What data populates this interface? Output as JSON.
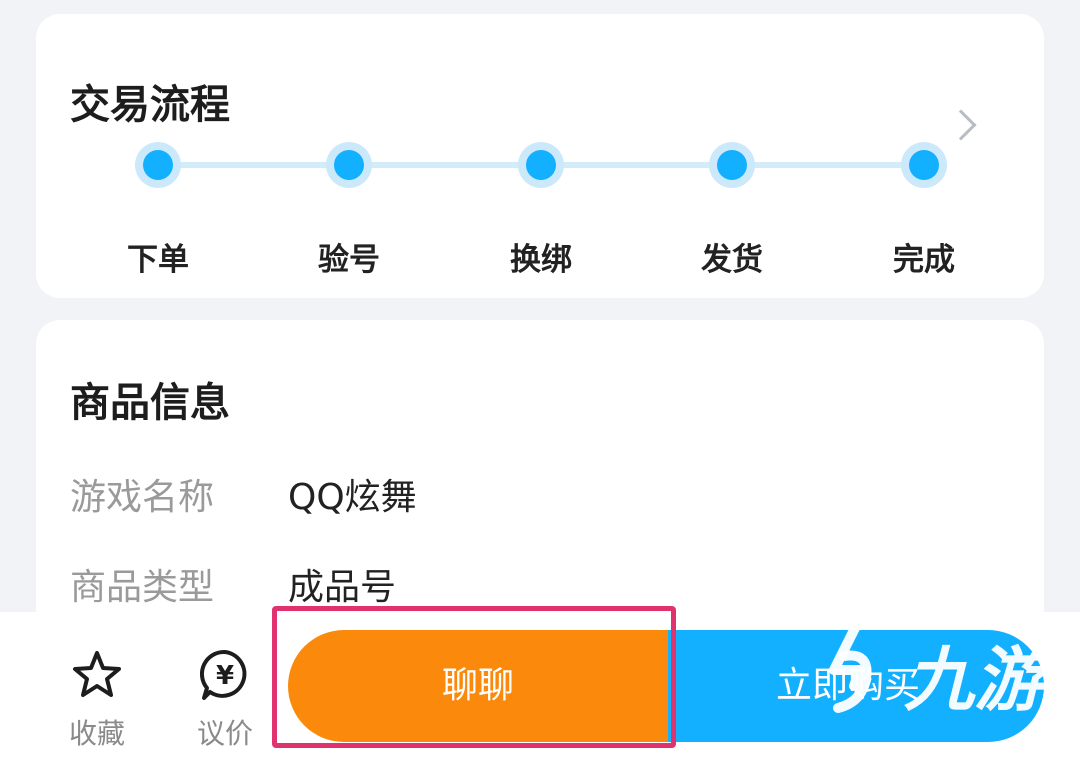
{
  "flow": {
    "title": "交易流程",
    "steps": [
      {
        "label": "下单"
      },
      {
        "label": "验号"
      },
      {
        "label": "换绑"
      },
      {
        "label": "发货"
      },
      {
        "label": "完成"
      }
    ]
  },
  "info": {
    "title": "商品信息",
    "rows": [
      {
        "label": "游戏名称",
        "value": "QQ炫舞"
      },
      {
        "label": "商品类型",
        "value": "成品号"
      }
    ]
  },
  "bottom": {
    "favorite_label": "收藏",
    "bargain_label": "议价",
    "chat_label": "聊聊",
    "buy_label": "立即购买",
    "bargain_icon_glyph": "¥"
  },
  "watermark": {
    "text": "九游"
  },
  "colors": {
    "accent_blue": "#12b0ff",
    "chat_orange": "#fb8a0c",
    "highlight_pink": "#e0326e"
  },
  "icons": [
    "chevron-right-icon",
    "star-icon",
    "yen-bubble-icon"
  ]
}
